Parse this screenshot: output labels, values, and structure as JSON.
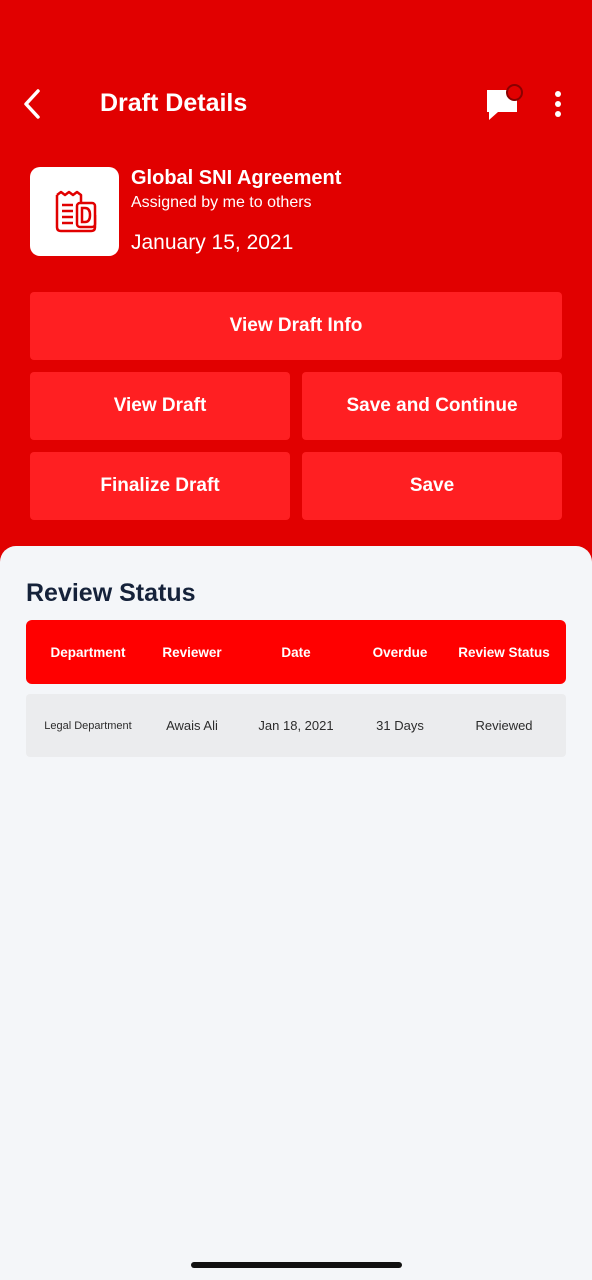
{
  "header": {
    "title": "Draft Details",
    "back_icon": "chevron-left-icon",
    "chat_icon": "chat-bubble-icon",
    "more_icon": "vertical-dots-icon"
  },
  "draft": {
    "icon": "draft-document-icon",
    "title": "Global SNI Agreement",
    "subtitle": "Assigned by me to others",
    "date": "January 15, 2021"
  },
  "actions": {
    "view_info": "View Draft Info",
    "view_draft": "View Draft",
    "save_continue": "Save and Continue",
    "finalize": "Finalize Draft",
    "save": "Save"
  },
  "review": {
    "title": "Review Status",
    "columns": [
      "Department",
      "Reviewer",
      "Date",
      "Overdue",
      "Review Status"
    ],
    "rows": [
      [
        "Legal Department",
        "Awais Ali",
        "Jan 18, 2021",
        "31 Days",
        "Reviewed"
      ]
    ]
  },
  "colors": {
    "brand_red": "#e10000",
    "button_red": "#ff1f22",
    "table_header_red": "#ff0000",
    "heading_navy": "#15223a"
  }
}
